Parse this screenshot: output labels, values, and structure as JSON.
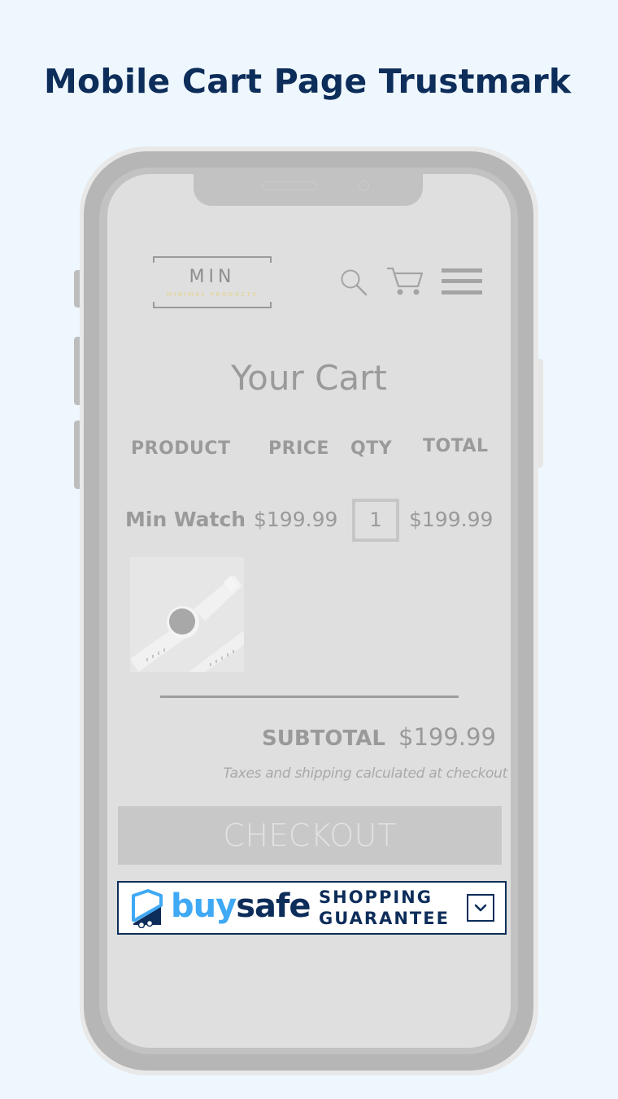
{
  "page": {
    "headline": "Mobile Cart Page Trustmark"
  },
  "store": {
    "logo": {
      "name": "MIN",
      "tagline": "MINIMAL PRODUCTS"
    },
    "header_icons": [
      "search-icon",
      "cart-icon",
      "menu-icon"
    ]
  },
  "cart": {
    "title": "Your Cart",
    "columns": [
      "PRODUCT",
      "PRICE",
      "QTY",
      "TOTAL"
    ],
    "items": [
      {
        "product": "Min Watch",
        "price": "$199.99",
        "qty": "1",
        "total": "$199.99",
        "image": "smartwatch-photo"
      }
    ],
    "subtotal_label": "SUBTOTAL",
    "subtotal_value": "$199.99",
    "tax_note": "Taxes and shipping calculated at checkout",
    "checkout_label": "CHECKOUT"
  },
  "trustmark": {
    "brand_part1": "buy",
    "brand_part2": "safe",
    "line1": "SHOPPING",
    "line2": "GUARANTEE",
    "icon": "chevron-down-icon",
    "colors": {
      "navy": "#0d2d5a",
      "light_blue": "#3fa9f5"
    }
  }
}
